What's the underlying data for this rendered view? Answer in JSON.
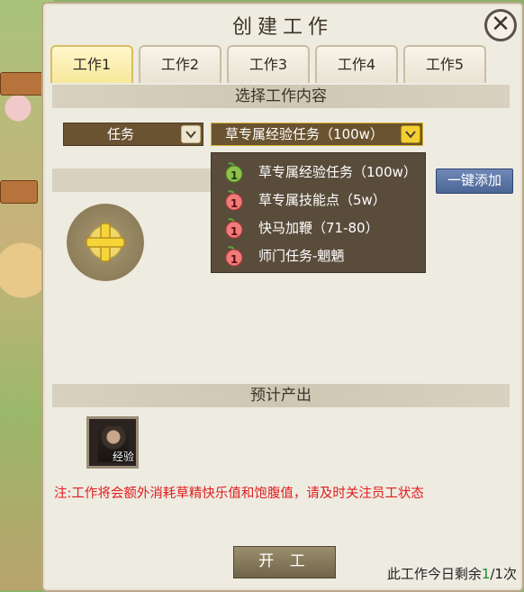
{
  "dialog": {
    "title": "创建工作",
    "close_glyph": "✕"
  },
  "tabs": [
    {
      "label": "工作1",
      "active": true
    },
    {
      "label": "工作2",
      "active": false
    },
    {
      "label": "工作3",
      "active": false
    },
    {
      "label": "工作4",
      "active": false
    },
    {
      "label": "工作5",
      "active": false
    }
  ],
  "select_section": {
    "title": "选择工作内容",
    "type_dropdown": "任务",
    "task_dropdown": "草专属经验任务（100w）",
    "add_all_label": "一键添加"
  },
  "task_options": [
    {
      "label": "草专属经验任务（100w）",
      "badge": "1",
      "badge_color": "green"
    },
    {
      "label": "草专属技能点（5w）",
      "badge": "1",
      "badge_color": "red"
    },
    {
      "label": "快马加鞭（71-80）",
      "badge": "1",
      "badge_color": "red"
    },
    {
      "label": "师门任务-魍魉",
      "badge": "1",
      "badge_color": "red"
    }
  ],
  "output_section": {
    "title": "预计产出",
    "item_label": "经验"
  },
  "note": "注:工作将会额外消耗草精快乐值和饱腹值，请及时关注员工状态",
  "start_label": "开 工",
  "remaining": {
    "prefix": "此工作今日剩余",
    "left": "1",
    "total": "/1",
    "suffix": "次"
  },
  "colors": {
    "note_red": "#e11d1d",
    "remain_green": "#1c8c2a",
    "tab_active": "#f7e79a",
    "add_all_blue": "#4b6596"
  }
}
